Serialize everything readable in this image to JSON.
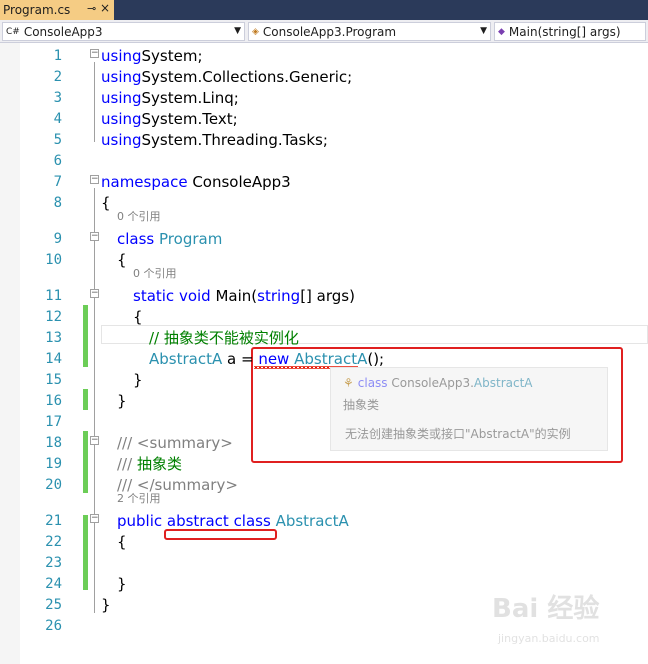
{
  "tab": {
    "title": "Program.cs",
    "pin_icon": "⊸",
    "close_icon": "×"
  },
  "navbar": {
    "project": "ConsoleApp3",
    "class": "ConsoleApp3.Program",
    "member": "Main(string[] args)"
  },
  "code": {
    "lines": [
      {
        "n": "1",
        "parts": [
          [
            "kw",
            "using"
          ],
          [
            "",
            "System;"
          ]
        ]
      },
      {
        "n": "2",
        "parts": [
          [
            "kw",
            "using"
          ],
          [
            "",
            "System.Collections.Generic;"
          ]
        ]
      },
      {
        "n": "3",
        "parts": [
          [
            "kw",
            "using"
          ],
          [
            "",
            "System.Linq;"
          ]
        ]
      },
      {
        "n": "4",
        "parts": [
          [
            "kw",
            "using"
          ],
          [
            "",
            "System.Text;"
          ]
        ]
      },
      {
        "n": "5",
        "parts": [
          [
            "kw",
            "using"
          ],
          [
            "",
            "System.Threading.Tasks;"
          ]
        ]
      },
      {
        "n": "6",
        "parts": []
      },
      {
        "n": "7",
        "parts": [
          [
            "kw",
            "namespace"
          ],
          [
            "",
            " ConsoleApp3"
          ]
        ]
      },
      {
        "n": "8",
        "parts": [
          [
            "",
            "{"
          ]
        ]
      },
      {
        "n": "9",
        "parts": [
          [
            "kw",
            "class"
          ],
          [
            "ty",
            " Program"
          ]
        ]
      },
      {
        "n": "10",
        "parts": [
          [
            "",
            "{"
          ]
        ]
      },
      {
        "n": "11",
        "parts": [
          [
            "kw",
            "static void"
          ],
          [
            "",
            " Main("
          ],
          [
            "kw",
            "string"
          ],
          [
            "",
            "[] args)"
          ]
        ]
      },
      {
        "n": "12",
        "parts": [
          [
            "",
            "{"
          ]
        ]
      },
      {
        "n": "13",
        "parts": [
          [
            "cm",
            "// 抽象类不能被实例化"
          ]
        ]
      },
      {
        "n": "14",
        "parts": [
          [
            "ty",
            "AbstractA"
          ],
          [
            "",
            " a = "
          ],
          [
            "kw",
            "new"
          ],
          [
            "",
            " "
          ],
          [
            "ty",
            "AbstractA"
          ],
          [
            "",
            "();"
          ]
        ]
      },
      {
        "n": "15",
        "parts": [
          [
            "",
            "}"
          ]
        ]
      },
      {
        "n": "16",
        "parts": [
          [
            "",
            "}"
          ]
        ]
      },
      {
        "n": "17",
        "parts": []
      },
      {
        "n": "18",
        "parts": [
          [
            "xg",
            "/// <summary>"
          ]
        ]
      },
      {
        "n": "19",
        "parts": [
          [
            "xg",
            "///"
          ],
          [
            "cm",
            " 抽象类"
          ]
        ]
      },
      {
        "n": "20",
        "parts": [
          [
            "xg",
            "/// </summary>"
          ]
        ]
      },
      {
        "n": "21",
        "parts": [
          [
            "kw",
            "public abstract class"
          ],
          [
            "ty",
            " AbstractA"
          ]
        ]
      },
      {
        "n": "22",
        "parts": [
          [
            "",
            "{"
          ]
        ]
      },
      {
        "n": "23",
        "parts": []
      },
      {
        "n": "24",
        "parts": [
          [
            "",
            "}"
          ]
        ]
      },
      {
        "n": "25",
        "parts": [
          [
            "",
            "}"
          ]
        ]
      },
      {
        "n": "26",
        "parts": []
      }
    ],
    "references": {
      "class_program": "0 个引用",
      "main": "0 个引用",
      "abstract_class": "2 个引用"
    }
  },
  "tooltip": {
    "icon": "⚘",
    "kw": "class",
    "ns": " ConsoleApp3.",
    "type": "AbstractA",
    "desc": "抽象类",
    "error": "无法创建抽象类或接口\"AbstractA\"的实例"
  },
  "watermark": {
    "logo": "Bai 经验",
    "url": "jingyan.baidu.com"
  },
  "colors": {
    "keyword": "#0000ff",
    "type": "#2b91af",
    "comment": "#008000",
    "annotation": "#e02020",
    "change_bar": "#6ccd57"
  }
}
